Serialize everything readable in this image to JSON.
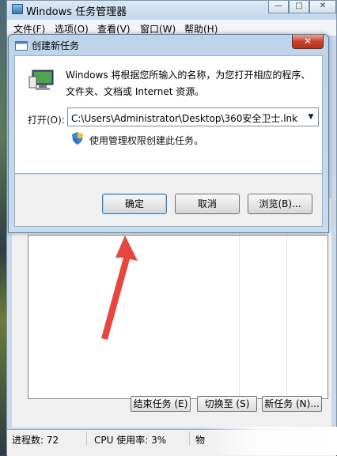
{
  "task_manager": {
    "title": "Windows 任务管理器",
    "window_controls": {
      "minimize": "—",
      "maximize": "□",
      "close": "✕"
    },
    "menu": [
      "文件(F)",
      "选项(O)",
      "查看(V)",
      "窗口(W)",
      "帮助(H)"
    ],
    "buttons": {
      "end_task": "结束任务 (E)",
      "switch_to": "切换至 (S)",
      "new_task": "新任务 (N)..."
    },
    "status": {
      "processes": "进程数: 72",
      "cpu": "CPU 使用率: 3%",
      "memory_partial": "物"
    }
  },
  "run_dialog": {
    "title": "创建新任务",
    "close_glyph": "✕",
    "description": "Windows 将根据您所输入的名称，为您打开相应的程序、文件夹、文档或 Internet 资源。",
    "open_label": "打开(O):",
    "open_value": "C:\\Users\\Administrator\\Desktop\\360安全卫士.lnk",
    "combo_arrow": "▼",
    "admin_checkbox_label": "使用管理权限创建此任务。",
    "buttons": {
      "ok": "确定",
      "cancel": "取消",
      "browse": "浏览(B)..."
    }
  },
  "colors": {
    "annotation_arrow": "#e8453c"
  },
  "icons": [
    "run-program-icon",
    "uac-shield-icon",
    "task-manager-icon",
    "dialog-icon"
  ]
}
